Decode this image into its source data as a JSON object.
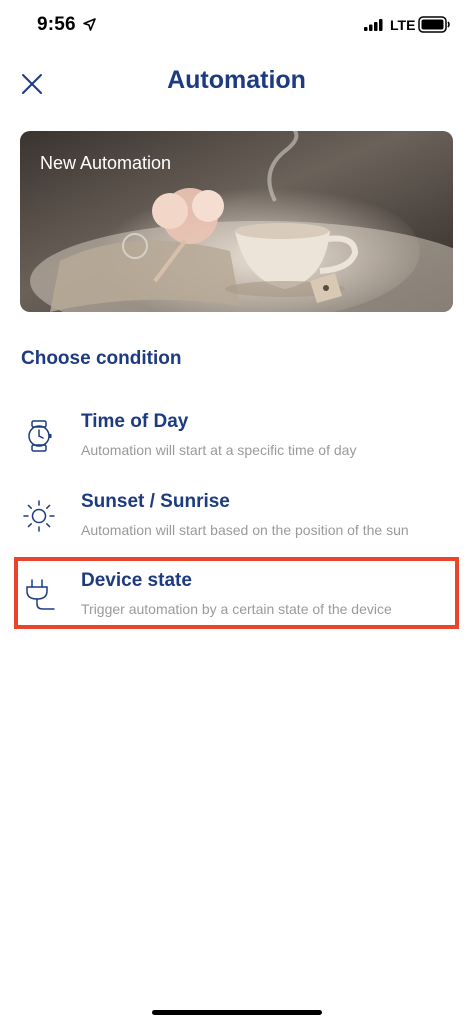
{
  "status_bar": {
    "time": "9:56",
    "network": "LTE",
    "icons": [
      "location-arrow-icon",
      "signal-bars-icon",
      "battery-icon"
    ]
  },
  "header": {
    "title": "Automation",
    "close_icon": "close-icon"
  },
  "banner": {
    "title": "New Automation"
  },
  "section": {
    "title": "Choose condition"
  },
  "options": [
    {
      "icon": "watch-icon",
      "label": "Time of Day",
      "description": "Automation will start at a specific time of day"
    },
    {
      "icon": "sun-icon",
      "label": "Sunset / Sunrise",
      "description": "Automation will start based on the position of the sun"
    },
    {
      "icon": "plug-icon",
      "label": "Device state",
      "description": "Trigger automation by a certain state of the device",
      "highlighted": true
    }
  ],
  "colors": {
    "primary": "#1c3b80",
    "secondary_text": "#9a9a9a",
    "highlight": "#e8452b"
  }
}
